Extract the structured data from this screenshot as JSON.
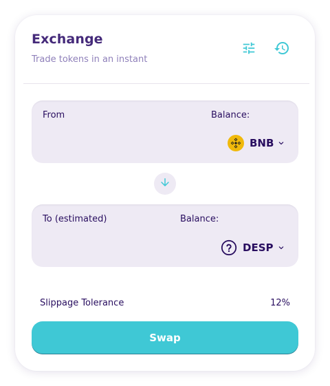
{
  "header": {
    "title": "Exchange",
    "subtitle": "Trade tokens in an instant",
    "settings_icon": "settings-sliders-icon",
    "history_icon": "history-clock-icon"
  },
  "from": {
    "label": "From",
    "balance_label": "Balance:",
    "token": "BNB",
    "token_icon": "bnb-token-icon"
  },
  "switch": {
    "icon": "arrow-down-icon"
  },
  "to": {
    "label": "To (estimated)",
    "balance_label": "Balance:",
    "token": "DESP",
    "token_icon": "unknown-token-icon"
  },
  "slippage": {
    "label": "Slippage Tolerance",
    "value": "12%"
  },
  "swap": {
    "label": "Swap"
  },
  "colors": {
    "primary_text": "#280d5f",
    "title": "#452a7a",
    "subtitle": "#8f80ba",
    "accent": "#3fc8d5",
    "panel_bg": "#eeeaf4",
    "bnb_yellow": "#f0b90b"
  }
}
